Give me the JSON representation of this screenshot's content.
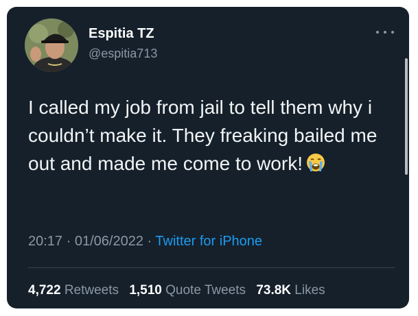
{
  "author": {
    "display_name": "Espitia TZ",
    "handle": "@espitia713",
    "avatar_icon": "profile-photo"
  },
  "tweet": {
    "text": "I called my job from jail to tell them why i couldn’t make it. They freaking bailed me out and made me come to work!",
    "emoji_icon": "loudly-crying-face-emoji"
  },
  "meta": {
    "time": "20:17",
    "separator": "·",
    "date": "01/06/2022",
    "source": "Twitter for iPhone"
  },
  "stats": {
    "retweets_count": "4,722",
    "retweets_label": "Retweets",
    "quotes_count": "1,510",
    "quotes_label": "Quote Tweets",
    "likes_count": "73.8K",
    "likes_label": "Likes"
  },
  "colors": {
    "background": "#15202b",
    "text_primary": "#ffffff",
    "text_secondary": "#8b98a5",
    "accent": "#1d9bf0"
  }
}
